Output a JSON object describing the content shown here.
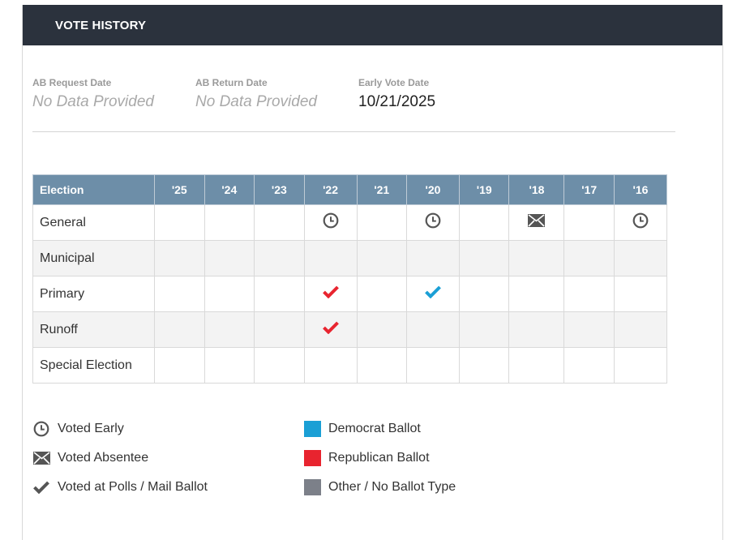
{
  "header": {
    "title": "VOTE HISTORY"
  },
  "dates": {
    "ab_request": {
      "label": "AB Request Date",
      "value": "No Data Provided"
    },
    "ab_return": {
      "label": "AB Return Date",
      "value": "No Data Provided"
    },
    "early_vote": {
      "label": "Early Vote Date",
      "value": "10/21/2025"
    }
  },
  "table": {
    "first_header": "Election",
    "years": [
      "'25",
      "'24",
      "'23",
      "'22",
      "'21",
      "'20",
      "'19",
      "'18",
      "'17",
      "'16"
    ],
    "rows": [
      {
        "label": "General",
        "cells": [
          "",
          "",
          "",
          "early",
          "",
          "early",
          "",
          "absentee",
          "",
          "early"
        ]
      },
      {
        "label": "Municipal",
        "cells": [
          "",
          "",
          "",
          "",
          "",
          "",
          "",
          "",
          "",
          ""
        ]
      },
      {
        "label": "Primary",
        "cells": [
          "",
          "",
          "",
          "polls-republican",
          "",
          "polls-democrat",
          "",
          "",
          "",
          ""
        ]
      },
      {
        "label": "Runoff",
        "cells": [
          "",
          "",
          "",
          "polls-republican",
          "",
          "",
          "",
          "",
          "",
          ""
        ]
      },
      {
        "label": "Special Election",
        "cells": [
          "",
          "",
          "",
          "",
          "",
          "",
          "",
          "",
          "",
          ""
        ]
      }
    ]
  },
  "legend": {
    "voted_early": "Voted Early",
    "voted_absentee": "Voted Absentee",
    "voted_polls": "Voted at Polls / Mail Ballot",
    "democrat": "Democrat Ballot",
    "republican": "Republican Ballot",
    "other": "Other / No Ballot Type"
  },
  "colors": {
    "header_bg": "#2b323d",
    "table_header_bg": "#6d8ea8",
    "democrat": "#1a9fd5",
    "republican": "#e8242f",
    "other": "#7c8089",
    "icon_gray": "#555555"
  },
  "icons": {
    "early": "clock-icon",
    "absentee": "envelope-icon",
    "polls": "checkmark-icon"
  }
}
